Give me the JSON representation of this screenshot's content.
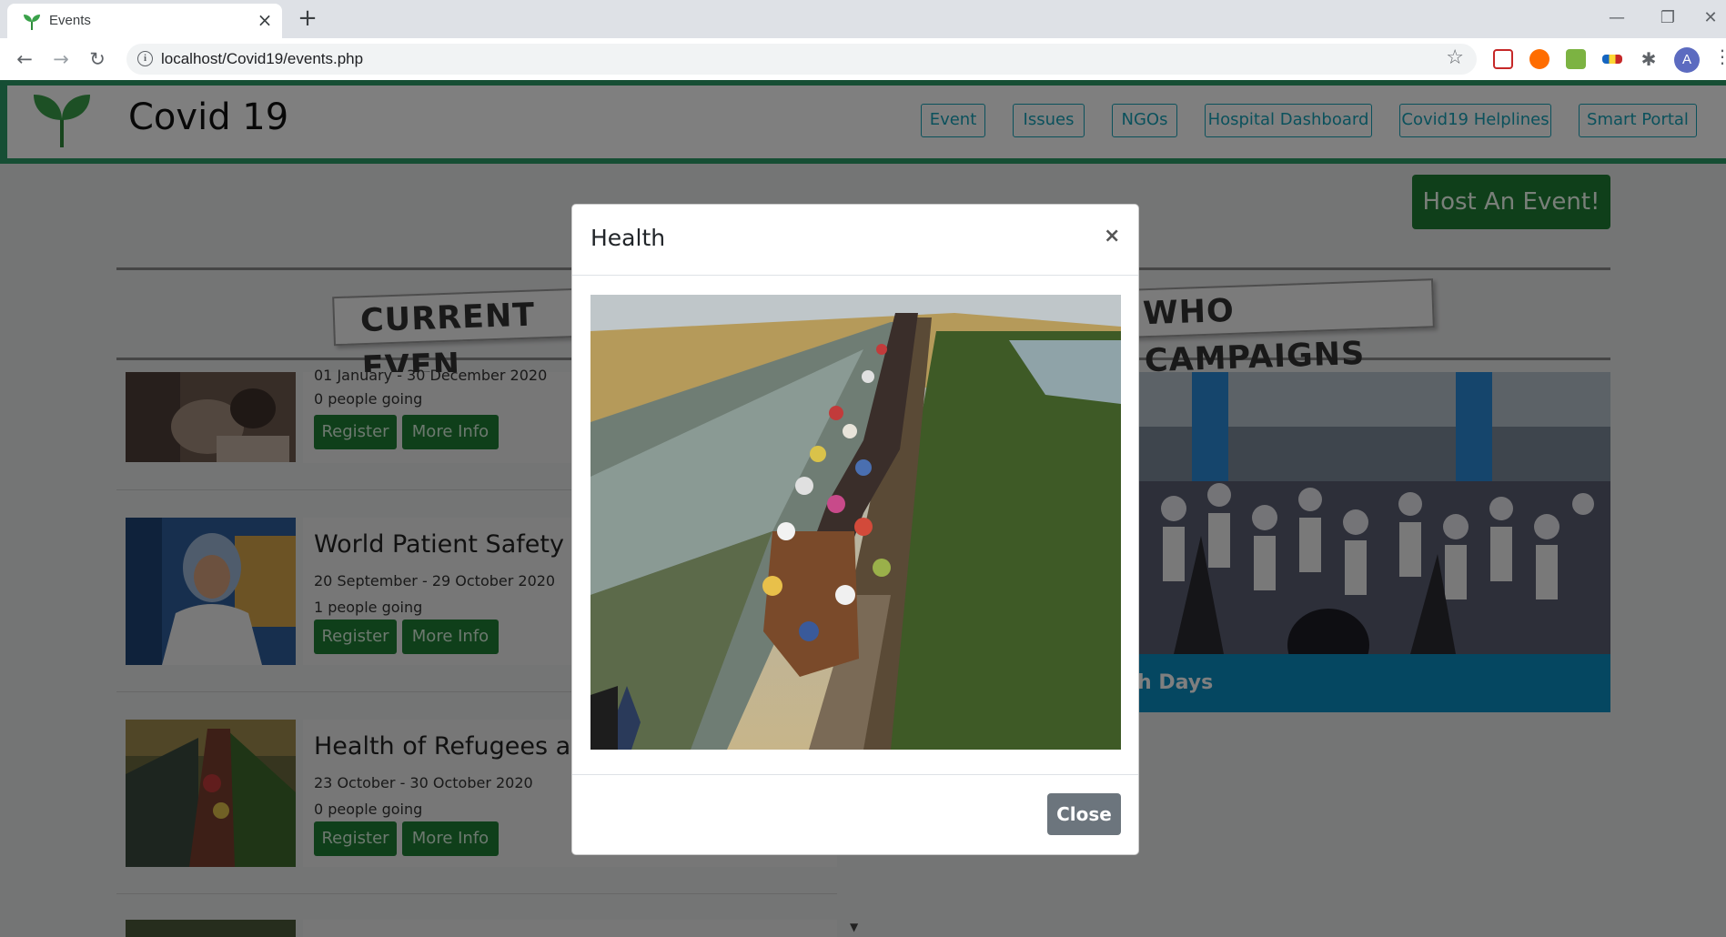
{
  "browser": {
    "tab_title": "Events",
    "tab_close": "×",
    "new_tab": "+",
    "url": "localhost/Covid19/events.php",
    "avatar_letter": "A",
    "window": {
      "minimize": "—",
      "restore": "❐",
      "close": "✕"
    }
  },
  "site": {
    "brand": "Covid 19",
    "nav": [
      "Event",
      "Issues",
      "NGOs",
      "Hospital Dashboard",
      "Covid19 Helplines",
      "Smart Portal"
    ],
    "host_button": "Host An Event!",
    "current_events_banner": "CURRENT EVEN",
    "who_banner": "WHO CAMPAIGNS"
  },
  "events": [
    {
      "title": "",
      "date": "01 January - 30 December 2020",
      "going": "0 people going",
      "register": "Register",
      "more": "More Info"
    },
    {
      "title": "World Patient Safety D",
      "date": "20 September - 29 October 2020",
      "going": "1 people going",
      "register": "Register",
      "more": "More Info"
    },
    {
      "title": "Health of Refugees and",
      "date": "23 October - 30 October 2020",
      "going": "0 people going",
      "register": "Register",
      "more": "More Info"
    }
  ],
  "campaign": {
    "caption": "h Days"
  },
  "modal": {
    "title": "Health",
    "close_x": "×",
    "close_button": "Close"
  },
  "colors": {
    "brand_green": "#2d9c69",
    "button_green": "#1e7e34",
    "nav_teal": "#17a2b8",
    "campaign_blue": "#0a8ec2",
    "close_gray": "#6c757d"
  }
}
